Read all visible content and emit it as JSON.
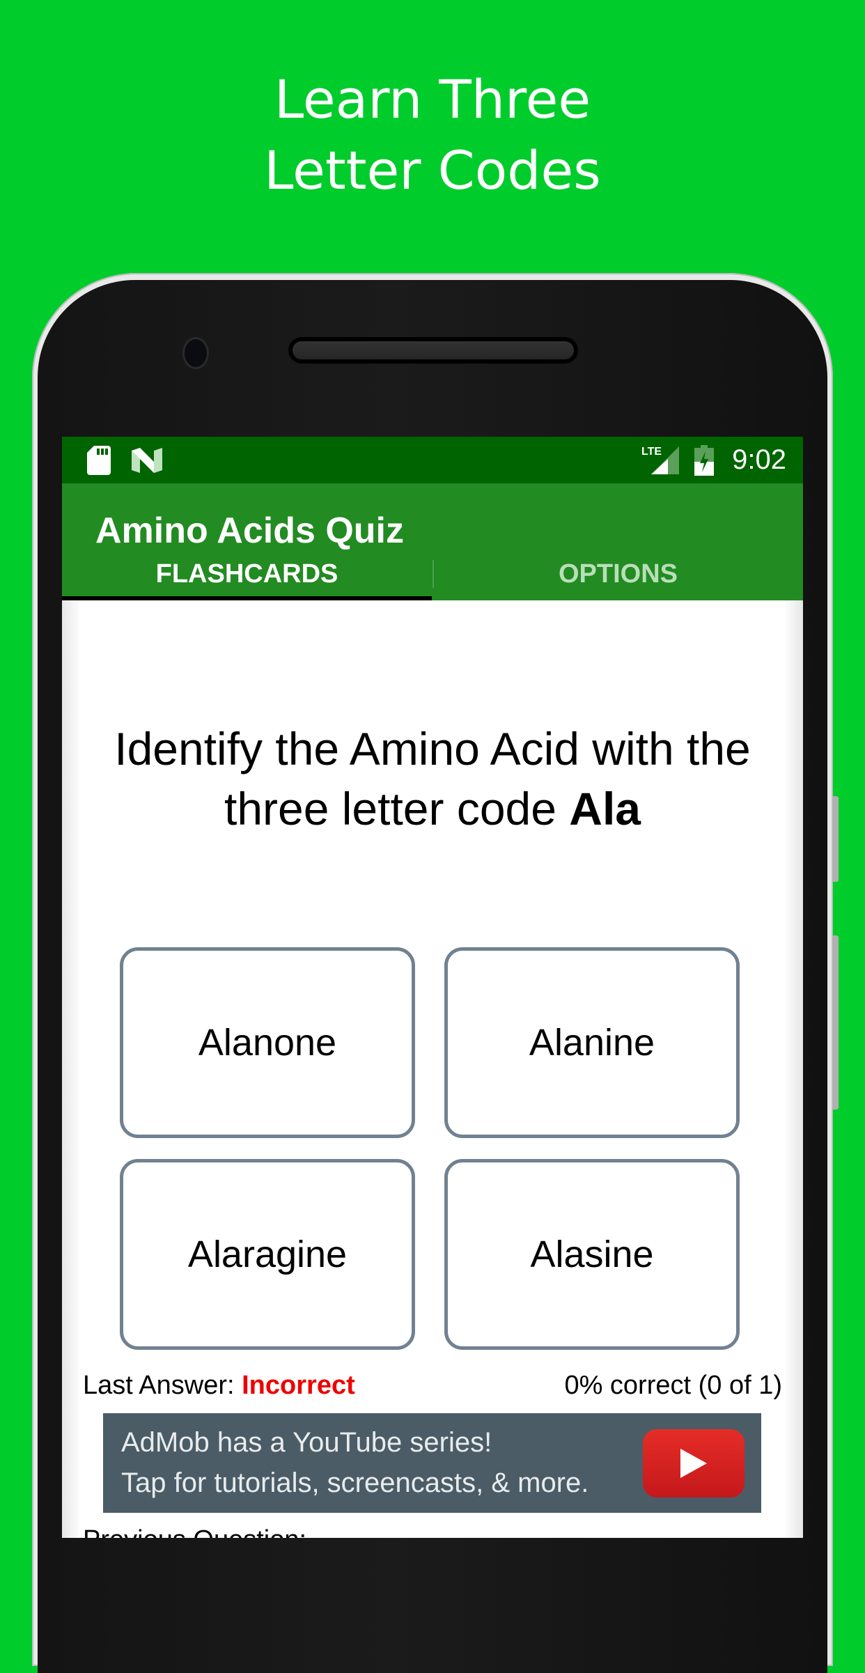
{
  "promo": {
    "headline_line1": "Learn Three",
    "headline_line2": "Letter Codes",
    "background_color": "#00cc2c"
  },
  "status_bar": {
    "left_icons": [
      "sd-card-icon",
      "n-logo-icon"
    ],
    "right_icons": [
      "lte-signal-icon",
      "battery-charging-icon"
    ],
    "network_label": "LTE",
    "time": "9:02"
  },
  "app_bar": {
    "title": "Amino Acids Quiz",
    "color": "#228b22",
    "tabs": [
      {
        "label": "FLASHCARDS",
        "selected": true
      },
      {
        "label": "OPTIONS",
        "selected": false
      }
    ]
  },
  "quiz": {
    "question_prefix": "Identify the Amino Acid with the three letter code ",
    "question_code": "Ala",
    "answers": [
      "Alanone",
      "Alanine",
      "Alaragine",
      "Alasine"
    ],
    "last_answer_label": "Last Answer: ",
    "last_answer_value": "Incorrect",
    "last_answer_color": "#ee0000",
    "score_text": "0% correct (0 of 1)",
    "previous_question_label": "Previous Question:"
  },
  "ad": {
    "line1": "AdMob has a YouTube series!",
    "line2": "Tap for tutorials, screencasts, & more.",
    "icon": "youtube-play-icon"
  }
}
